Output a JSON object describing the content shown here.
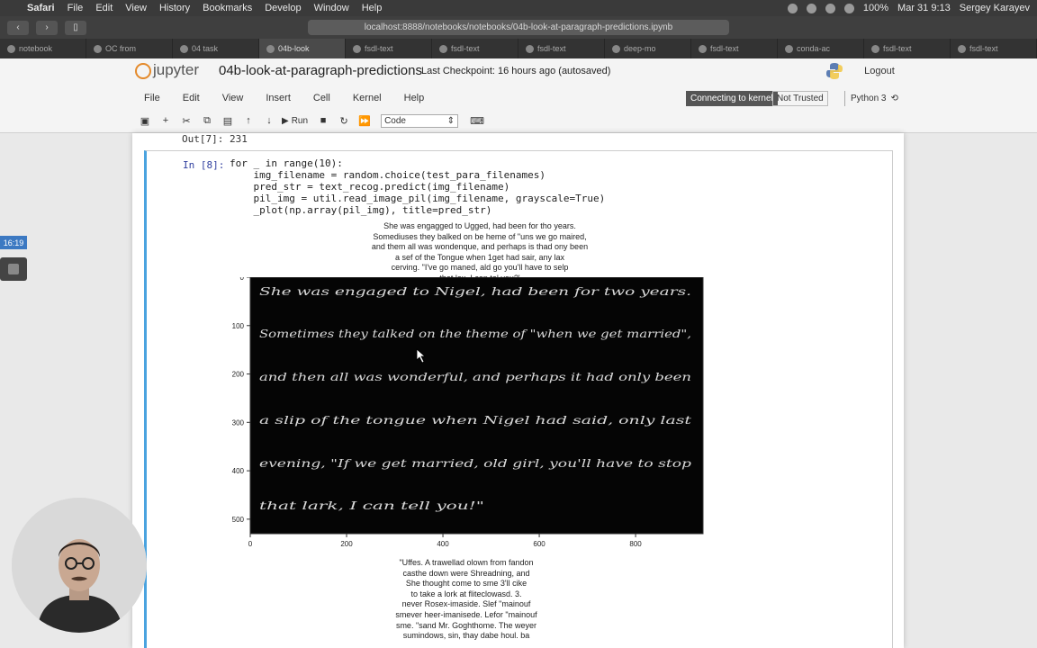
{
  "menubar": {
    "app_name": "Safari",
    "items": [
      "File",
      "Edit",
      "View",
      "History",
      "Bookmarks",
      "Develop",
      "Window",
      "Help"
    ],
    "battery": "100%",
    "datetime": "Mar 31  9:13",
    "user": "Sergey Karayev"
  },
  "browser": {
    "url": "localhost:8888/notebooks/notebooks/04b-look-at-paragraph-predictions.ipynb",
    "tabs": [
      "notebook",
      "OC from",
      "04 task",
      "04b-look",
      "fsdl-text",
      "fsdl-text",
      "fsdl-text",
      "deep-mo",
      "fsdl-text",
      "conda-ac",
      "fsdl-text",
      "fsdl-text"
    ],
    "active_tab_index": 3
  },
  "jupyter": {
    "logo_text": "jupyter",
    "notebook_title": "04b-look-at-paragraph-predictions",
    "checkpoint": "Last Checkpoint: 16 hours ago",
    "autosave": "(autosaved)",
    "logout": "Logout",
    "menus": [
      "File",
      "Edit",
      "View",
      "Insert",
      "Cell",
      "Kernel",
      "Help"
    ],
    "kernel_status": "Connecting to kernel",
    "trusted": "Not Trusted",
    "kernel_name": "Python 3",
    "run_label": "Run",
    "cell_type": "Code"
  },
  "cells": {
    "prev_output": "Out[7]:  231",
    "in_prompt": "In [8]:",
    "code_lines": [
      "for _ in range(10):",
      "    img_filename = random.choice(test_para_filenames)",
      "    pred_str = text_recog.predict(img_filename)",
      "    pil_img = util.read_image_pil(img_filename, grayscale=True)",
      "    _plot(np.array(pil_img), title=pred_str)"
    ],
    "prediction_title_lines": [
      "She was engagged to Ugged, had been for tho years.",
      "Somediuses they balked on be heme of \"uns we go maired,",
      "and them all was wondenque, and perhaps is thad ony been",
      "a sef of the Tongue when 1get had sair, any lax",
      "cerving. \"I've go maned, ald go you'll have to selp",
      "that lax. I can tel you?'"
    ],
    "prediction2_lines": [
      "\"Uffes. A trawellad olown from fandon",
      "casthe down were Shreadning, and",
      "She thought come to sme 3'll cike",
      "to take a lork at fliteclowasd. 3.",
      "never Rosex-imaside. Slef \"mainouf",
      "smever heer-imanisede. Lefor \"mainouf",
      "sme. \"sand Mr. Goghthome. The weyer",
      "sumindows, sin, thay dabe houl. ba"
    ]
  },
  "handwriting_lines": [
    "She was engaged to Nigel, had been for two years.",
    "Sometimes they talked on the theme of \"when we get married\",",
    "and then all was wonderful, and perhaps it had only been",
    "a slip of the tongue when Nigel had said, only last",
    "evening, \"If we get married, old girl, you'll have to stop",
    "that lark, I can tell you!\""
  ],
  "chart_data": {
    "type": "image",
    "x_ticks": [
      "0",
      "200",
      "400",
      "600",
      "800"
    ],
    "y_ticks": [
      "0",
      "100",
      "200",
      "300",
      "400",
      "500"
    ],
    "xlim": [
      0,
      940
    ],
    "ylim": [
      530,
      0
    ]
  },
  "overlay": {
    "timer": "16:19"
  },
  "colors": {
    "cell_border": "#4aa3df",
    "kernel_badge": "#555555",
    "logo_orange": "#e48a2b",
    "timer_blue": "#3c79c2"
  }
}
